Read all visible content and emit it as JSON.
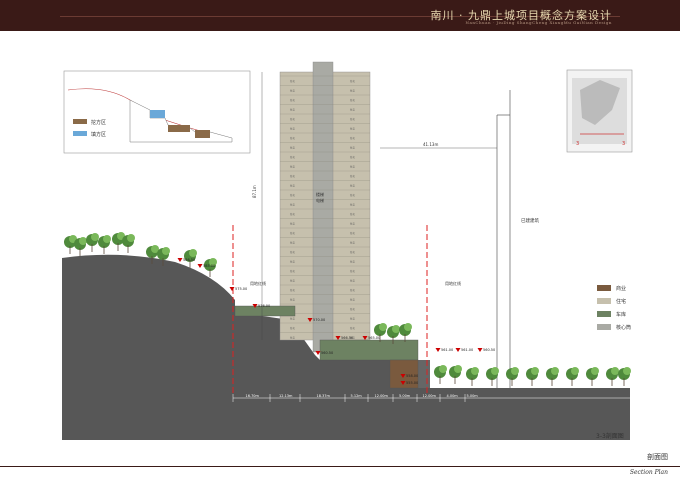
{
  "header": {
    "title": "南川 · 九鼎上城项目概念方案设计",
    "subtitle": "NanChuan · JiuDing ShangCheng XiangMu GaiNian Design"
  },
  "footer": {
    "cn": "剖面图",
    "en": "Section Plan"
  },
  "section_name": "3-3剖面图",
  "inset_legend": {
    "cut": "挖方区",
    "fill": "填方区"
  },
  "legend": [
    {
      "label": "商业",
      "color": "#7a5a3e"
    },
    {
      "label": "住宅",
      "color": "#c6c0ad"
    },
    {
      "label": "车库",
      "color": "#6d8262"
    },
    {
      "label": "核心筒",
      "color": "#a9aaa4"
    }
  ],
  "labels": {
    "existing_building": "已建建筑",
    "redline_left": "用地红线",
    "redline_right": "用地红线",
    "core": "楼梯\n电梯",
    "height": "87.1m",
    "top_distance": "41.13m"
  },
  "elevations": [
    "586.50",
    "585.00",
    "575.00",
    "576.00",
    "570.00",
    "566.50",
    "565.00",
    "560.50",
    "561.00",
    "561.00",
    "560.50",
    "558.00",
    "555.00"
  ],
  "dimensions": [
    "16.70m",
    "12.13m",
    "18.37m",
    "5.12m",
    "12.00m",
    "5.00m",
    "12.00m",
    "4.00m",
    "5.00m"
  ],
  "floor_label": "住宅"
}
